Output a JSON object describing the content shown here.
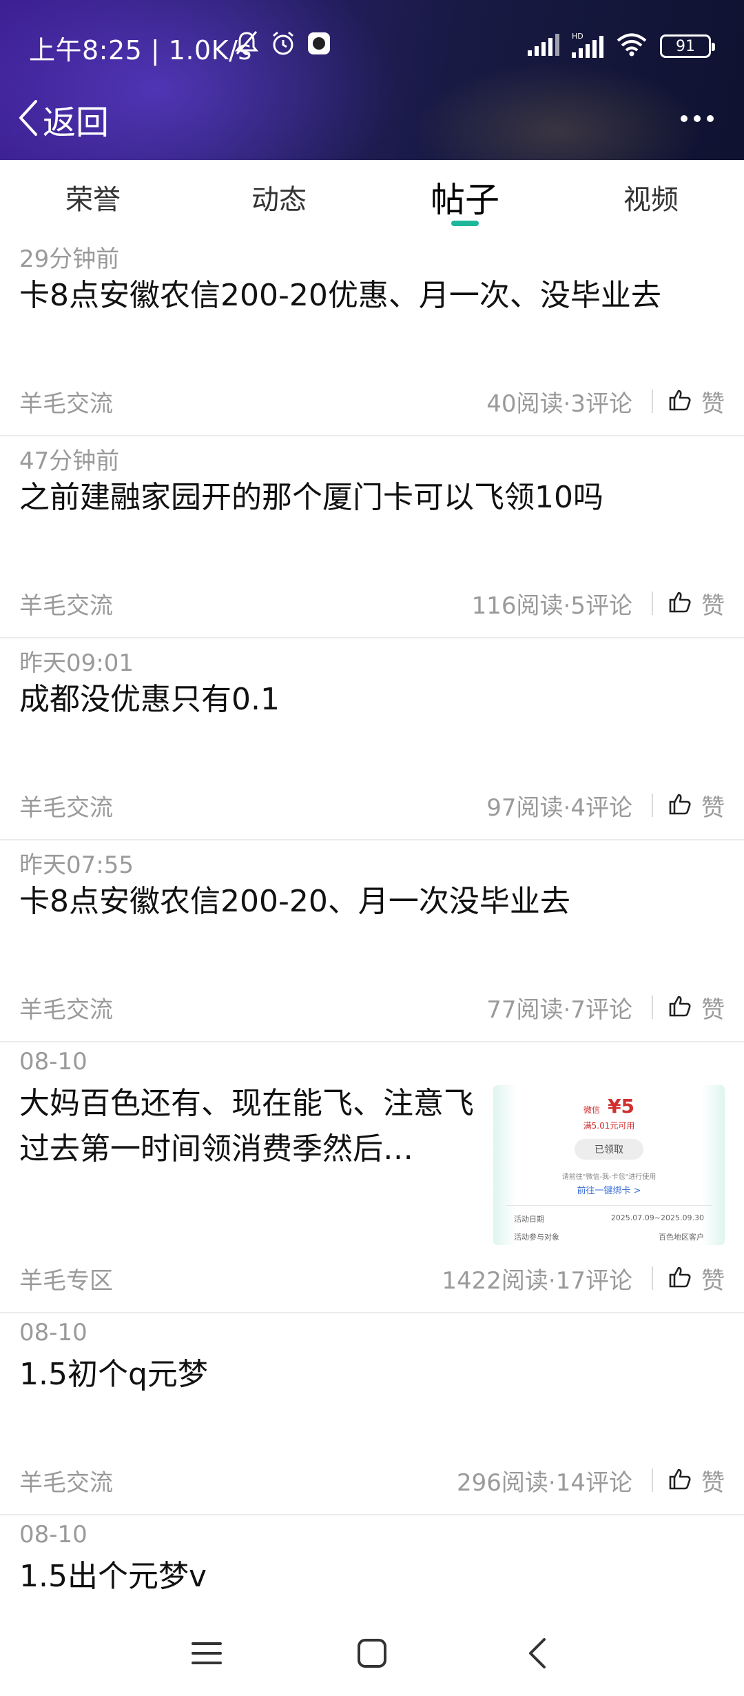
{
  "status_bar": {
    "time": "上午8:25 | 1.0K/s",
    "battery": "91"
  },
  "nav": {
    "back_label": "返回"
  },
  "tabs": [
    {
      "label": "荣誉",
      "active": false
    },
    {
      "label": "动态",
      "active": false
    },
    {
      "label": "帖子",
      "active": true
    },
    {
      "label": "视频",
      "active": false
    }
  ],
  "colors": {
    "accent": "#1db89a",
    "secondary_text": "#9a9a9a"
  },
  "posts": [
    {
      "time": "29分钟前",
      "title": "卡8点安徽农信200-20优惠、月一次、没毕业去",
      "board": "羊毛交流",
      "stats": "40阅读·3评论",
      "like_label": "赞"
    },
    {
      "time": "47分钟前",
      "title": "之前建融家园开的那个厦门卡可以飞领10吗",
      "board": "羊毛交流",
      "stats": "116阅读·5评论",
      "like_label": "赞"
    },
    {
      "time": "昨天09:01",
      "title": "成都没优惠只有0.1",
      "board": "羊毛交流",
      "stats": "97阅读·4评论",
      "like_label": "赞"
    },
    {
      "time": "昨天07:55",
      "title": "卡8点安徽农信200-20、月一次没毕业去",
      "board": "羊毛交流",
      "stats": "77阅读·7评论",
      "like_label": "赞"
    },
    {
      "time": "08-10",
      "title": "大妈百色还有、现在能飞、注意飞过去第一时间领消费季然后…",
      "board": "羊毛专区",
      "stats": "1422阅读·17评论",
      "like_label": "赞",
      "thumbnail": {
        "brand": "微信",
        "amount": "¥5",
        "condition": "满5.01元可用",
        "status": "已领取",
        "note": "请前往\"微信-我-卡包\"进行使用",
        "link": "前往一键绑卡 >",
        "row1_label": "活动日期",
        "row1_value": "2025.07.09~2025.09.30",
        "row2_label": "活动参与对象",
        "row2_value": "百色地区客户"
      }
    },
    {
      "time": "08-10",
      "title": "1.5初个q元梦",
      "board": "羊毛交流",
      "stats": "296阅读·14评论",
      "like_label": "赞"
    },
    {
      "time": "08-10",
      "title": "1.5出个元梦v",
      "board": "",
      "stats": "",
      "like_label": ""
    }
  ],
  "icons": {
    "mute": "bell-slash-icon",
    "alarm": "alarm-icon",
    "app_notice": "app-notification-icon",
    "signal": "signal-icon",
    "wifi": "wifi-icon",
    "battery": "battery-icon",
    "back": "chevron-left-icon",
    "more": "more-dots-icon",
    "like": "thumbs-up-icon"
  }
}
